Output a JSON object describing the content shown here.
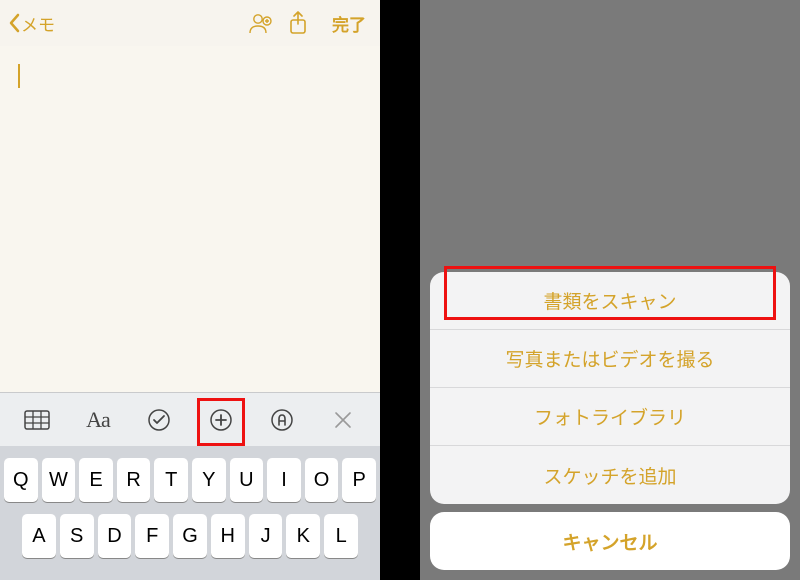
{
  "left": {
    "back_label": "メモ",
    "done_label": "完了",
    "format_bar": {
      "aa": "Aa"
    },
    "keyboard": {
      "row1": [
        "Q",
        "W",
        "E",
        "R",
        "T",
        "Y",
        "U",
        "I",
        "O",
        "P"
      ],
      "row2": [
        "A",
        "S",
        "D",
        "F",
        "G",
        "H",
        "J",
        "K",
        "L"
      ]
    }
  },
  "right": {
    "sheet": {
      "scan": "書類をスキャン",
      "camera": "写真またはビデオを撮る",
      "library": "フォトライブラリ",
      "sketch": "スケッチを追加"
    },
    "cancel": "キャンセル"
  },
  "colors": {
    "accent": "#d4a32a",
    "highlight": "#e11"
  }
}
